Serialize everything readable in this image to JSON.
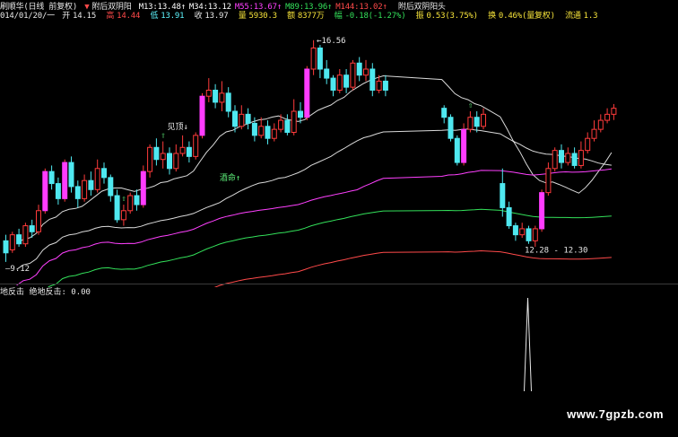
{
  "header": {
    "line1": {
      "title": "刷顺华(日线 前复权)",
      "item_marker": "▼",
      "item_label": "附后双阴阳",
      "ma_items": [
        {
          "label": "M13:",
          "value": "13.48",
          "arrow": "↑",
          "color": "#ffffff"
        },
        {
          "label": "M34:",
          "value": "13.12",
          "arrow": "",
          "color": "#ffffff"
        },
        {
          "label": "M55:",
          "value": "13.67",
          "arrow": "↑",
          "color": "#ff40ff"
        },
        {
          "label": "M89:",
          "value": "13.96",
          "arrow": "↑",
          "color": "#33e05a"
        },
        {
          "label": "M144:",
          "value": "13.02",
          "arrow": "↑",
          "color": "#ff4a4a"
        }
      ],
      "right_label": "附后双阴阳头"
    },
    "line2": {
      "date": "014/01/20/一",
      "open_label": "开",
      "open": "14.15",
      "high_label": "高",
      "high": "14.44",
      "low_label": "低",
      "low": "13.91",
      "close_label": "收",
      "close": "13.97",
      "vol_label": "量",
      "vol": "5930.3",
      "amount_label": "额",
      "amount": "8377万",
      "change_label": "幅",
      "change": "-0.18(-1.27%)",
      "amp_label": "振",
      "amp": "0.53(3.75%)",
      "turnover_label": "换",
      "turnover": "0.46%(量复权)",
      "float_label": "流通",
      "float": "1.3"
    }
  },
  "main_chart": {
    "type": "candlestick",
    "price_range": [
      8.6,
      17.0
    ],
    "high_label": "16.56",
    "low_label": "9.12",
    "gap_range_label": "12.28 - 12.30",
    "signals": [
      {
        "text": "见顶",
        "arrow": "↓"
      },
      {
        "text": "酒命",
        "arrow": "↑"
      }
    ]
  },
  "sub_chart": {
    "title": "地反击",
    "indicator_label": "绝地反击:",
    "indicator_value": "0.00",
    "spike_value": 1
  },
  "watermark": "www.7gpzb.com",
  "chart_data": {
    "type": "candlestick",
    "series": [
      {
        "name": "M13",
        "color": "#ffffff"
      },
      {
        "name": "M34",
        "color": "#ffffff"
      },
      {
        "name": "M55",
        "color": "#ff40ff"
      },
      {
        "name": "M89",
        "color": "#33e05a"
      },
      {
        "name": "M144",
        "color": "#ff4a4a"
      }
    ],
    "candles": [
      {
        "o": 9.9,
        "c": 9.5,
        "h": 10.1,
        "l": 9.2
      },
      {
        "o": 9.6,
        "c": 10.1,
        "h": 10.2,
        "l": 9.5
      },
      {
        "o": 10.1,
        "c": 9.8,
        "h": 10.3,
        "l": 9.7
      },
      {
        "o": 9.8,
        "c": 10.4,
        "h": 10.5,
        "l": 9.7
      },
      {
        "o": 10.4,
        "c": 10.2,
        "h": 10.6,
        "l": 10.0
      },
      {
        "o": 10.2,
        "c": 10.9,
        "h": 11.1,
        "l": 10.1
      },
      {
        "o": 10.9,
        "c": 12.2,
        "h": 12.3,
        "l": 10.8
      },
      {
        "o": 12.2,
        "c": 11.8,
        "h": 12.4,
        "l": 11.6
      },
      {
        "o": 11.8,
        "c": 11.3,
        "h": 12.0,
        "l": 11.1
      },
      {
        "o": 11.3,
        "c": 12.5,
        "h": 12.6,
        "l": 11.2
      },
      {
        "o": 12.5,
        "c": 11.7,
        "h": 12.7,
        "l": 11.5
      },
      {
        "o": 11.7,
        "c": 11.3,
        "h": 11.9,
        "l": 11.0
      },
      {
        "o": 11.3,
        "c": 11.9,
        "h": 12.1,
        "l": 11.2
      },
      {
        "o": 11.9,
        "c": 11.6,
        "h": 12.2,
        "l": 11.4
      },
      {
        "o": 11.6,
        "c": 12.3,
        "h": 12.6,
        "l": 11.5
      },
      {
        "o": 12.3,
        "c": 12.0,
        "h": 12.5,
        "l": 11.8
      },
      {
        "o": 12.0,
        "c": 11.4,
        "h": 12.1,
        "l": 11.2
      },
      {
        "o": 11.4,
        "c": 10.6,
        "h": 11.6,
        "l": 10.5
      },
      {
        "o": 10.6,
        "c": 10.9,
        "h": 11.1,
        "l": 10.4
      },
      {
        "o": 10.9,
        "c": 11.4,
        "h": 11.5,
        "l": 10.8
      },
      {
        "o": 11.4,
        "c": 11.1,
        "h": 11.6,
        "l": 10.9
      },
      {
        "o": 11.1,
        "c": 12.2,
        "h": 12.4,
        "l": 11.0
      },
      {
        "o": 12.2,
        "c": 13.0,
        "h": 13.1,
        "l": 12.0
      },
      {
        "o": 13.0,
        "c": 12.6,
        "h": 13.3,
        "l": 12.4
      },
      {
        "o": 12.6,
        "c": 12.8,
        "h": 13.2,
        "l": 12.3
      },
      {
        "o": 12.8,
        "c": 12.3,
        "h": 13.0,
        "l": 12.1
      },
      {
        "o": 12.3,
        "c": 12.8,
        "h": 13.1,
        "l": 12.2
      },
      {
        "o": 12.8,
        "c": 13.0,
        "h": 13.4,
        "l": 12.7
      },
      {
        "o": 13.0,
        "c": 12.7,
        "h": 13.2,
        "l": 12.5
      },
      {
        "o": 12.7,
        "c": 13.4,
        "h": 13.5,
        "l": 12.6
      },
      {
        "o": 13.4,
        "c": 14.7,
        "h": 14.8,
        "l": 13.3
      },
      {
        "o": 14.7,
        "c": 14.9,
        "h": 15.3,
        "l": 14.5
      },
      {
        "o": 14.9,
        "c": 14.5,
        "h": 15.1,
        "l": 14.3
      },
      {
        "o": 14.5,
        "c": 14.8,
        "h": 15.2,
        "l": 14.2
      },
      {
        "o": 14.8,
        "c": 14.2,
        "h": 15.0,
        "l": 14.0
      },
      {
        "o": 14.2,
        "c": 13.7,
        "h": 14.4,
        "l": 13.5
      },
      {
        "o": 13.7,
        "c": 14.1,
        "h": 14.4,
        "l": 13.6
      },
      {
        "o": 14.1,
        "c": 13.8,
        "h": 14.3,
        "l": 13.6
      },
      {
        "o": 13.8,
        "c": 13.4,
        "h": 14.0,
        "l": 13.2
      },
      {
        "o": 13.4,
        "c": 13.7,
        "h": 14.0,
        "l": 13.3
      },
      {
        "o": 13.7,
        "c": 13.3,
        "h": 13.9,
        "l": 13.1
      },
      {
        "o": 13.3,
        "c": 13.6,
        "h": 13.8,
        "l": 13.2
      },
      {
        "o": 13.6,
        "c": 13.9,
        "h": 14.1,
        "l": 13.5
      },
      {
        "o": 13.9,
        "c": 13.5,
        "h": 14.1,
        "l": 13.4
      },
      {
        "o": 13.5,
        "c": 14.2,
        "h": 14.6,
        "l": 13.4
      },
      {
        "o": 14.2,
        "c": 14.0,
        "h": 14.5,
        "l": 13.8
      },
      {
        "o": 14.0,
        "c": 15.6,
        "h": 15.7,
        "l": 13.9
      },
      {
        "o": 15.6,
        "c": 16.3,
        "h": 16.56,
        "l": 15.4
      },
      {
        "o": 16.3,
        "c": 15.6,
        "h": 16.4,
        "l": 15.3
      },
      {
        "o": 15.6,
        "c": 15.3,
        "h": 15.9,
        "l": 15.1
      },
      {
        "o": 15.3,
        "c": 14.9,
        "h": 15.4,
        "l": 14.7
      },
      {
        "o": 14.9,
        "c": 15.4,
        "h": 15.6,
        "l": 14.8
      },
      {
        "o": 15.4,
        "c": 15.0,
        "h": 15.6,
        "l": 14.8
      },
      {
        "o": 15.0,
        "c": 15.8,
        "h": 15.9,
        "l": 14.9
      },
      {
        "o": 15.8,
        "c": 15.4,
        "h": 16.0,
        "l": 15.2
      },
      {
        "o": 15.4,
        "c": 15.6,
        "h": 15.9,
        "l": 15.2
      },
      {
        "o": 15.6,
        "c": 14.9,
        "h": 15.8,
        "l": 14.7
      },
      {
        "o": 14.9,
        "c": 15.2,
        "h": 15.4,
        "l": 14.8
      },
      {
        "o": 15.2,
        "c": 14.9,
        "h": 15.4,
        "l": 14.7
      },
      {
        "o": 14.3,
        "c": 14.0,
        "h": 14.4,
        "l": 13.8,
        "gap": true
      },
      {
        "o": 14.0,
        "c": 13.3,
        "h": 14.1,
        "l": 13.2
      },
      {
        "o": 13.3,
        "c": 12.5,
        "h": 13.4,
        "l": 12.4
      },
      {
        "o": 12.5,
        "c": 13.6,
        "h": 13.8,
        "l": 12.4
      },
      {
        "o": 13.6,
        "c": 14.0,
        "h": 14.2,
        "l": 13.5
      },
      {
        "o": 14.0,
        "c": 13.7,
        "h": 14.2,
        "l": 13.5
      },
      {
        "o": 13.7,
        "c": 14.1,
        "h": 14.3,
        "l": 13.6
      },
      {
        "o": 11.8,
        "c": 11.0,
        "h": 12.3,
        "l": 10.7,
        "gap": true
      },
      {
        "o": 11.0,
        "c": 10.4,
        "h": 11.2,
        "l": 10.3
      },
      {
        "o": 10.4,
        "c": 10.1,
        "h": 10.5,
        "l": 9.9
      },
      {
        "o": 10.1,
        "c": 10.3,
        "h": 10.5,
        "l": 10.0
      },
      {
        "o": 10.3,
        "c": 9.9,
        "h": 10.4,
        "l": 9.8
      },
      {
        "o": 9.9,
        "c": 10.3,
        "h": 10.4,
        "l": 9.7
      },
      {
        "o": 10.3,
        "c": 11.5,
        "h": 11.6,
        "l": 10.2
      },
      {
        "o": 11.5,
        "c": 12.3,
        "h": 12.5,
        "l": 11.4
      },
      {
        "o": 12.3,
        "c": 12.9,
        "h": 13.0,
        "l": 12.2
      },
      {
        "o": 12.9,
        "c": 12.5,
        "h": 13.1,
        "l": 12.3
      },
      {
        "o": 12.5,
        "c": 12.8,
        "h": 13.0,
        "l": 12.4
      },
      {
        "o": 12.8,
        "c": 12.4,
        "h": 13.0,
        "l": 12.3
      },
      {
        "o": 12.4,
        "c": 12.9,
        "h": 13.2,
        "l": 12.3
      },
      {
        "o": 12.9,
        "c": 13.3,
        "h": 13.5,
        "l": 12.8
      },
      {
        "o": 13.3,
        "c": 13.6,
        "h": 13.9,
        "l": 13.2
      },
      {
        "o": 13.6,
        "c": 13.9,
        "h": 14.1,
        "l": 13.5
      },
      {
        "o": 13.9,
        "c": 14.1,
        "h": 14.3,
        "l": 13.8
      },
      {
        "o": 14.1,
        "c": 14.3,
        "h": 14.44,
        "l": 13.91
      }
    ]
  }
}
